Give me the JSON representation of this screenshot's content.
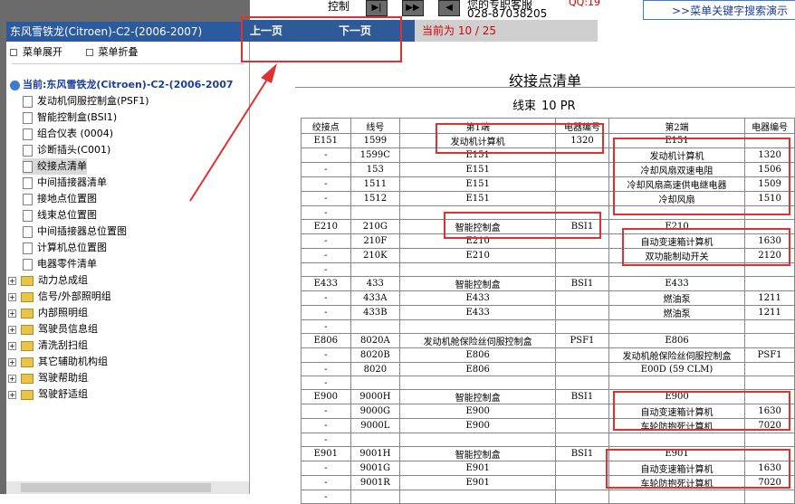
{
  "top": {
    "label_control": "控制",
    "qq_text": "QQ:19",
    "tel_text": "您的专职客服",
    "phone": "028-87038205",
    "search_hint": ">>菜单关键字搜索演示"
  },
  "sidebar": {
    "header": "东风雪铁龙(Citroen)-C2-(2006-2007)",
    "expand_label": "菜单展开",
    "collapse_label": "菜单折叠",
    "current": "当前:东风雪铁龙(Citroen)-C2-(2006-2007",
    "items": [
      "发动机伺服控制盒(PSF1)",
      "智能控制盒(BSI1)",
      "组合仪表 (0004)",
      "诊断插头(C001)",
      "绞接点清单",
      "中间插接器清单",
      "接地点位置图",
      "线束总位置图",
      "中间插接器总位置图",
      "计算机总位置图",
      "电器零件清单"
    ],
    "folders": [
      "动力总成组",
      "信号/外部照明组",
      "内部照明组",
      "驾驶员信息组",
      "清洗刮扫组",
      "其它辅助机构组",
      "驾驶帮助组",
      "驾驶舒适组"
    ]
  },
  "nav": {
    "prev": "上一页",
    "next": "下一页",
    "page_status": "当前为 10 / 25"
  },
  "content": {
    "title": "绞接点清单",
    "subtitle": "线束",
    "subtitle_code": "10 PR"
  },
  "table": {
    "headers": [
      "绞接点",
      "线号",
      "第1端",
      "电器编号",
      "第2端",
      "电器编号"
    ],
    "rows": [
      [
        "E151",
        "1599",
        "发动机计算机",
        "1320",
        "E151",
        ""
      ],
      [
        "-",
        "1599C",
        "E151",
        "",
        "发动机计算机",
        "1320"
      ],
      [
        "-",
        "153",
        "E151",
        "",
        "冷却风扇双速电阻",
        "1506"
      ],
      [
        "-",
        "1511",
        "E151",
        "",
        "冷却风扇高速供电继电器",
        "1509"
      ],
      [
        "-",
        "1512",
        "E151",
        "",
        "冷却风扇",
        "1510"
      ],
      [
        "-",
        "",
        "",
        "",
        "",
        ""
      ],
      [
        "E210",
        "210G",
        "智能控制盒",
        "BSI1",
        "E210",
        ""
      ],
      [
        "-",
        "210F",
        "E210",
        "",
        "自动变速箱计算机",
        "1630"
      ],
      [
        "-",
        "210K",
        "E210",
        "",
        "双功能制动开关",
        "2120"
      ],
      [
        "-",
        "",
        "",
        "",
        "",
        ""
      ],
      [
        "E433",
        "433",
        "智能控制盒",
        "BSI1",
        "E433",
        ""
      ],
      [
        "-",
        "433A",
        "E433",
        "",
        "燃油泵",
        "1211"
      ],
      [
        "-",
        "433B",
        "E433",
        "",
        "燃油泵",
        "1211"
      ],
      [
        "-",
        "",
        "",
        "",
        "",
        ""
      ],
      [
        "E806",
        "8020A",
        "发动机舱保险丝伺服控制盒",
        "PSF1",
        "E806",
        ""
      ],
      [
        "-",
        "8020B",
        "E806",
        "",
        "发动机舱保险丝伺服控制盒",
        "PSF1"
      ],
      [
        "-",
        "8020",
        "E806",
        "",
        "E00D (59 CLM)",
        ""
      ],
      [
        "-",
        "",
        "",
        "",
        "",
        ""
      ],
      [
        "E900",
        "9000H",
        "智能控制盒",
        "BSI1",
        "E900",
        ""
      ],
      [
        "-",
        "9000G",
        "E900",
        "",
        "自动变速箱计算机",
        "1630"
      ],
      [
        "-",
        "9000L",
        "E900",
        "",
        "车轮防抱死计算机",
        "7020"
      ],
      [
        "-",
        "",
        "",
        "",
        "",
        ""
      ],
      [
        "E901",
        "9001H",
        "智能控制盒",
        "BSI1",
        "E901",
        ""
      ],
      [
        "-",
        "9001G",
        "E901",
        "",
        "自动变速箱计算机",
        "1630"
      ],
      [
        "-",
        "9001R",
        "E901",
        "",
        "车轮防抱死计算机",
        "7020"
      ],
      [
        "-",
        "",
        "",
        "",
        "",
        ""
      ]
    ]
  },
  "colors": {
    "accent": "#2e5a98",
    "highlight": "#e03030"
  }
}
